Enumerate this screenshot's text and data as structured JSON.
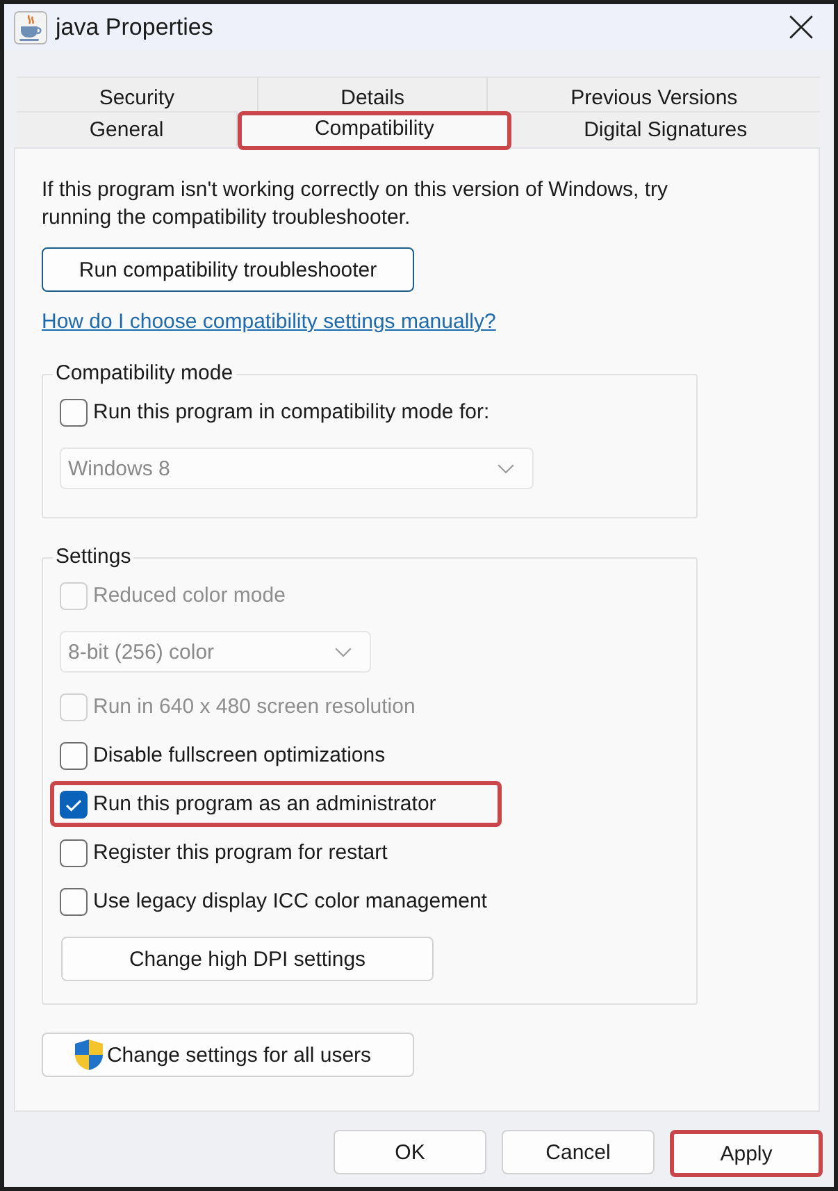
{
  "window": {
    "title": "java Properties"
  },
  "tab_rows": [
    {
      "tabs": [
        {
          "label": "Security",
          "selected": false,
          "highlighted": false
        },
        {
          "label": "Details",
          "selected": false,
          "highlighted": false
        },
        {
          "label": "Previous Versions",
          "selected": false,
          "highlighted": false
        }
      ]
    },
    {
      "tabs": [
        {
          "label": "General",
          "selected": false,
          "highlighted": false
        },
        {
          "label": "Compatibility",
          "selected": true,
          "highlighted": true
        },
        {
          "label": "Digital Signatures",
          "selected": false,
          "highlighted": false
        }
      ]
    }
  ],
  "intro_text": "If this program isn't working correctly on this version of Windows, try running the compatibility troubleshooter.",
  "troubleshooter_button": {
    "label": "Run compatibility troubleshooter",
    "default": true
  },
  "help_link": "How do I choose compatibility settings manually?",
  "compatibility_mode": {
    "title": "Compatibility mode",
    "items": [
      {
        "kind": "checkbox",
        "label": "Run this program in compatibility mode for:",
        "checked": false,
        "disabled": false,
        "highlighted": false
      },
      {
        "kind": "dropdown",
        "value": "Windows 8",
        "disabled": true
      }
    ]
  },
  "settings": {
    "title": "Settings",
    "items": [
      {
        "kind": "checkbox",
        "label": "Reduced color mode",
        "checked": false,
        "disabled": true,
        "highlighted": false
      },
      {
        "kind": "dropdown",
        "value": "8-bit (256) color",
        "disabled": true
      },
      {
        "kind": "checkbox",
        "label": "Run in 640 x 480 screen resolution",
        "checked": false,
        "disabled": true,
        "highlighted": false
      },
      {
        "kind": "checkbox",
        "label": "Disable fullscreen optimizations",
        "checked": false,
        "disabled": false,
        "highlighted": false
      },
      {
        "kind": "checkbox",
        "label": "Run this program as an administrator",
        "checked": true,
        "disabled": false,
        "highlighted": true
      },
      {
        "kind": "checkbox",
        "label": "Register this program for restart",
        "checked": false,
        "disabled": false,
        "highlighted": false
      },
      {
        "kind": "checkbox",
        "label": "Use legacy display ICC color management",
        "checked": false,
        "disabled": false,
        "highlighted": false
      },
      {
        "kind": "button",
        "label": "Change high DPI settings"
      }
    ]
  },
  "all_users_button": {
    "label": "Change settings for all users"
  },
  "buttons": [
    {
      "label": "OK",
      "highlighted": false
    },
    {
      "label": "Cancel",
      "highlighted": false
    },
    {
      "label": "Apply",
      "highlighted": true
    }
  ]
}
